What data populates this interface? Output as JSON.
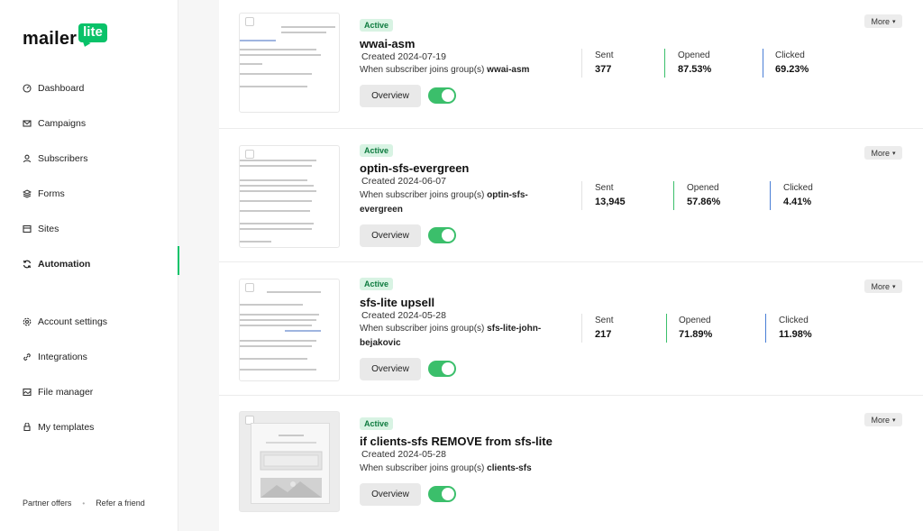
{
  "brand": {
    "word": "mailer",
    "badge": "lite"
  },
  "nav": {
    "top": [
      {
        "label": "Dashboard"
      },
      {
        "label": "Campaigns"
      },
      {
        "label": "Subscribers"
      },
      {
        "label": "Forms"
      },
      {
        "label": "Sites"
      },
      {
        "label": "Automation"
      }
    ],
    "bottom": [
      {
        "label": "Account settings"
      },
      {
        "label": "Integrations"
      },
      {
        "label": "File manager"
      },
      {
        "label": "My templates"
      }
    ]
  },
  "footer": {
    "partner": "Partner offers",
    "refer": "Refer a friend"
  },
  "automations": [
    {
      "status": "Active",
      "name": "wwai-asm",
      "created": "Created 2024-07-19",
      "trigger_prefix": "When subscriber joins group(s)",
      "trigger_group": "wwai-asm",
      "overview": "Overview",
      "more": "More",
      "stats": {
        "sent_label": "Sent",
        "sent": "377",
        "opened_label": "Opened",
        "opened": "87.53%",
        "clicked_label": "Clicked",
        "clicked": "69.23%"
      }
    },
    {
      "status": "Active",
      "name": "optin-sfs-evergreen",
      "created": "Created 2024-06-07",
      "trigger_prefix": "When subscriber joins group(s)",
      "trigger_group": "optin-sfs-evergreen",
      "overview": "Overview",
      "more": "More",
      "stats": {
        "sent_label": "Sent",
        "sent": "13,945",
        "opened_label": "Opened",
        "opened": "57.86%",
        "clicked_label": "Clicked",
        "clicked": "4.41%"
      }
    },
    {
      "status": "Active",
      "name": "sfs-lite upsell",
      "created": "Created 2024-05-28",
      "trigger_prefix": "When subscriber joins group(s)",
      "trigger_group": "sfs-lite-john-bejakovic",
      "overview": "Overview",
      "more": "More",
      "stats": {
        "sent_label": "Sent",
        "sent": "217",
        "opened_label": "Opened",
        "opened": "71.89%",
        "clicked_label": "Clicked",
        "clicked": "11.98%"
      }
    },
    {
      "status": "Active",
      "name": "if clients-sfs REMOVE from sfs-lite",
      "created": "Created 2024-05-28",
      "trigger_prefix": "When subscriber joins group(s)",
      "trigger_group": "clients-sfs",
      "overview": "Overview",
      "more": "More"
    }
  ],
  "colors": {
    "accent": "#09c269",
    "toggle_on": "#3bbf6b",
    "opened_rule": "#3bbf6b",
    "clicked_rule": "#4a7fd6",
    "badge_bg": "#d8f3e3"
  },
  "icons": [
    "dashboard-icon",
    "campaigns-icon",
    "subscribers-icon",
    "forms-icon",
    "sites-icon",
    "automation-icon",
    "account-settings-icon",
    "integrations-icon",
    "file-manager-icon",
    "templates-icon"
  ]
}
